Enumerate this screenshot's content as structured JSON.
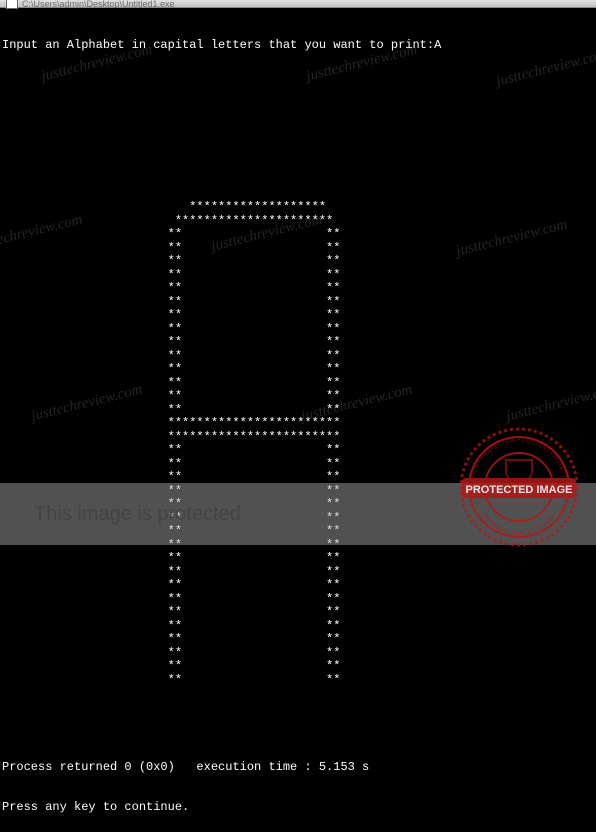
{
  "titlebar": {
    "path": "C:\\Users\\admin\\Desktop\\Untitled1.exe"
  },
  "console": {
    "prompt": "Input an Alphabet in capital letters that you want to print:",
    "input_value": "A",
    "ascii_art": [
      "                          *******************",
      "                        **********************",
      "                       **                    **",
      "                       **                    **",
      "                       **                    **",
      "                       **                    **",
      "                       **                    **",
      "                       **                    **",
      "                       **                    **",
      "                       **                    **",
      "                       **                    **",
      "                       **                    **",
      "                       **                    **",
      "                       **                    **",
      "                       **                    **",
      "                       **                    **",
      "                       ************************",
      "                       ************************",
      "                       **                    **",
      "                       **                    **",
      "                       **                    **",
      "                       **                    **",
      "                       **                    **",
      "                       **                    **",
      "                       **                    **",
      "                       **                    **",
      "                       **                    **",
      "                       **                    **",
      "                       **                    **",
      "                       **                    **",
      "                       **                    **",
      "                       **                    **",
      "                       **                    **",
      "                       **                    **",
      "                       **                    **",
      "                       **                    **"
    ],
    "status_line": "Process returned 0 (0x0)   execution time : 5.153 s",
    "continue_prompt": "Press any key to continue."
  },
  "watermark": {
    "text": "justtechreview.com"
  },
  "protection": {
    "overlay_text": "This image is protected",
    "stamp_text": "PROTECTED IMAGE",
    "stamp_subtext": "My Website Name & URL Here"
  }
}
